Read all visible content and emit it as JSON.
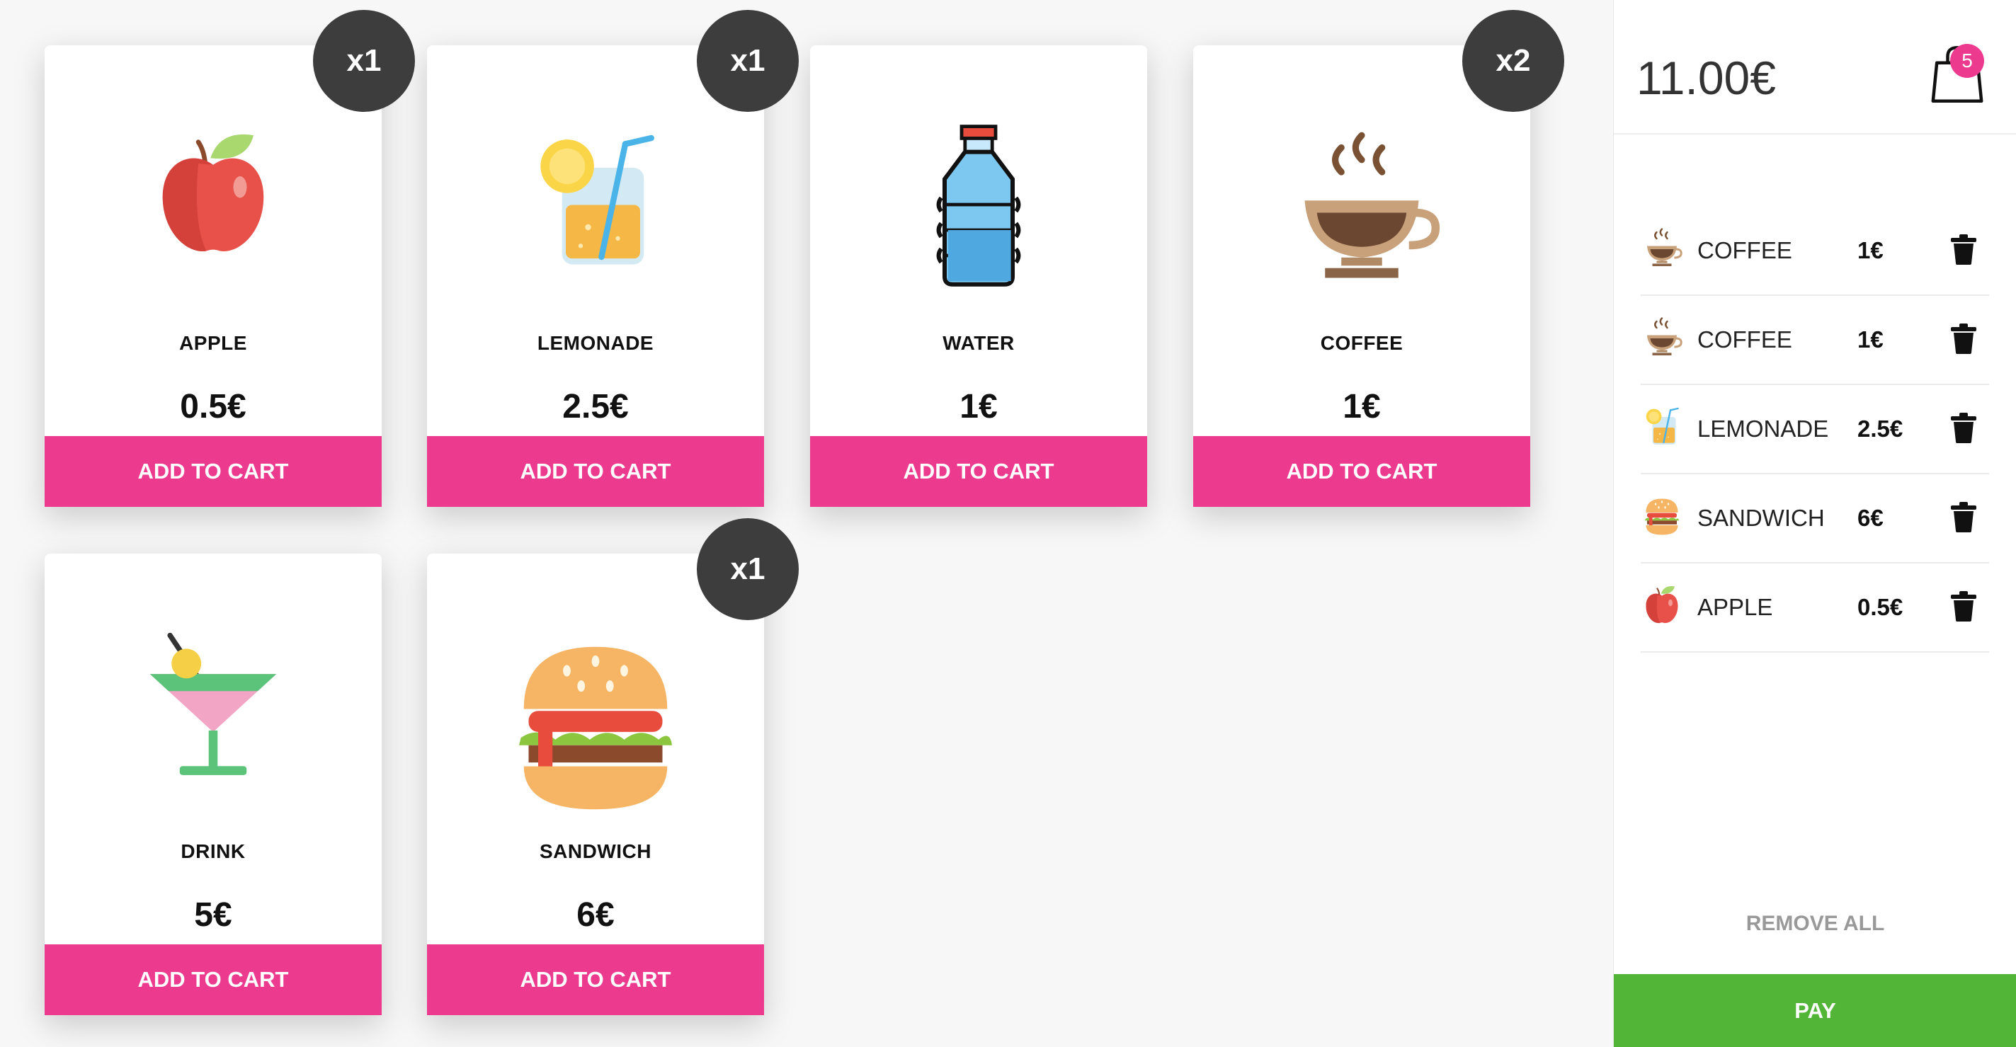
{
  "products": [
    {
      "name": "APPLE",
      "price": "0.5€",
      "button": "ADD TO CART",
      "badge": "x1",
      "icon": "apple-icon"
    },
    {
      "name": "LEMONADE",
      "price": "2.5€",
      "button": "ADD TO CART",
      "badge": "x1",
      "icon": "lemonade-icon"
    },
    {
      "name": "WATER",
      "price": "1€",
      "button": "ADD TO CART",
      "badge": "",
      "icon": "water-bottle-icon"
    },
    {
      "name": "COFFEE",
      "price": "1€",
      "button": "ADD TO CART",
      "badge": "x2",
      "icon": "coffee-cup-icon"
    },
    {
      "name": "DRINK",
      "price": "5€",
      "button": "ADD TO CART",
      "badge": "",
      "icon": "cocktail-icon"
    },
    {
      "name": "SANDWICH",
      "price": "6€",
      "button": "ADD TO CART",
      "badge": "x1",
      "icon": "burger-icon"
    }
  ],
  "cart": {
    "total": "11.00€",
    "count": "5",
    "items": [
      {
        "name": "COFFEE",
        "price": "1€",
        "icon": "coffee-cup-icon"
      },
      {
        "name": "COFFEE",
        "price": "1€",
        "icon": "coffee-cup-icon"
      },
      {
        "name": "LEMONADE",
        "price": "2.5€",
        "icon": "lemonade-icon"
      },
      {
        "name": "SANDWICH",
        "price": "6€",
        "icon": "burger-icon"
      },
      {
        "name": "APPLE",
        "price": "0.5€",
        "icon": "apple-icon"
      }
    ],
    "remove_all": "REMOVE ALL",
    "pay": "PAY"
  },
  "colors": {
    "accent": "#ec3a8f",
    "pay": "#52b538",
    "badge": "#3d3d3d"
  }
}
